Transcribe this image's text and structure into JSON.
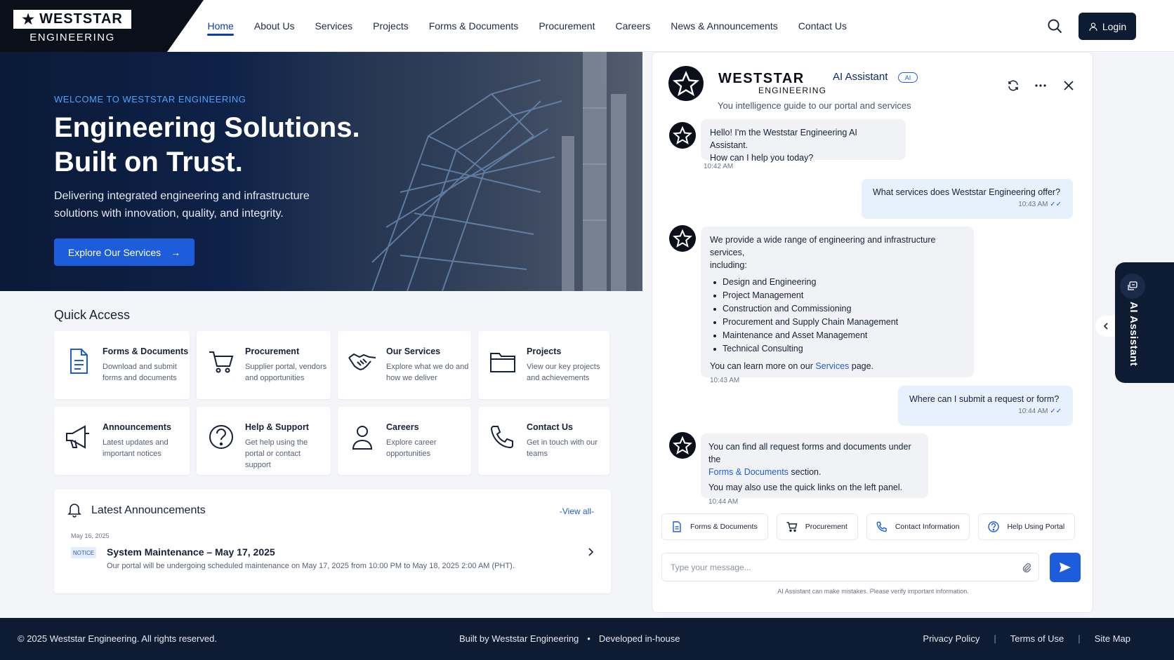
{
  "brand": {
    "name": "WESTSTAR",
    "sub": "ENGINEERING"
  },
  "nav": {
    "items": [
      "Home",
      "About Us",
      "Services",
      "Projects",
      "Forms & Documents",
      "Procurement",
      "Careers",
      "News & Announcements",
      "Contact Us"
    ],
    "active": "Home",
    "login_label": "Login"
  },
  "hero": {
    "eyebrow": "WELCOME TO WESTSTAR ENGINEERING",
    "title_line1": "Engineering Solutions.",
    "title_line2": "Built on Trust.",
    "subtitle": "Delivering integrated engineering and infrastructure solutions with innovation, quality, and integrity.",
    "cta_label": "Explore Our Services"
  },
  "quick_access": {
    "title": "Quick Access",
    "cards": [
      {
        "title": "Forms & Documents",
        "desc": "Download and submit forms and documents",
        "icon": "document-icon"
      },
      {
        "title": "Procurement",
        "desc": "Supplier portal, vendors and opportunities",
        "icon": "cart-icon"
      },
      {
        "title": "Our Services",
        "desc": "Explore what we do and how we deliver",
        "icon": "handshake-icon"
      },
      {
        "title": "Projects",
        "desc": "View our key projects and achievements",
        "icon": "folder-icon"
      },
      {
        "title": "Announcements",
        "desc": "Latest updates and important notices",
        "icon": "megaphone-icon"
      },
      {
        "title": "Help & Support",
        "desc": "Get help using the portal or contact support",
        "icon": "help-icon"
      },
      {
        "title": "Careers",
        "desc": "Explore career opportunities",
        "icon": "person-icon"
      },
      {
        "title": "Contact Us",
        "desc": "Get in touch with our teams",
        "icon": "phone-icon"
      }
    ]
  },
  "announcements": {
    "title": "Latest Announcements",
    "view_all": "-View all-",
    "items": [
      {
        "date": "May 16, 2025",
        "badge": "NOTICE",
        "title": "System Maintenance – May 17, 2025",
        "desc": "Our portal will be undergoing scheduled maintenance on May 17, 2025 from 10:00 PM to May 18, 2025 2:00 AM (PHT)."
      }
    ]
  },
  "chat": {
    "brand": "WESTSTAR",
    "brand_sub": "ENGINEERING",
    "name": "AI Assistant",
    "badge": "AI",
    "tagline": "You intelligence guide to our portal and services",
    "messages": [
      {
        "from": "bot",
        "text1": "Hello! I'm the Weststar Engineering AI Assistant.",
        "text2": "How can I help you today?",
        "time": "10:42 AM"
      },
      {
        "from": "user",
        "text": "What services does Weststar Engineering offer?",
        "time": "10:43 AM"
      },
      {
        "from": "bot",
        "intro1": "We provide a wide range of engineering and infrastructure services,",
        "intro2": "including:",
        "list": [
          "Design and Engineering",
          "Project Management",
          "Construction and Commissioning",
          "Procurement and Supply Chain Management",
          "Maintenance and Asset Management",
          "Technical Consulting"
        ],
        "outro_pre": "You can learn more on our ",
        "outro_link": "Services",
        "outro_post": " page.",
        "time": "10:43 AM"
      },
      {
        "from": "user",
        "text": "Where can I submit a request or form?",
        "time": "10:44 AM"
      },
      {
        "from": "bot",
        "l1": "You can find all request forms and documents under the",
        "link": "Forms & Documents",
        "l2": " section.",
        "l3": "You may also use the quick links on the left panel.",
        "time": "10:44 AM"
      }
    ],
    "chips": [
      "Forms & Documents",
      "Procurement",
      "Contact Information",
      "Help Using Portal"
    ],
    "placeholder": "Type your message...",
    "disclaimer": "AI Assistant can make mistakes. Please verify important information."
  },
  "side_tab": {
    "label": "AI Assistant"
  },
  "footer": {
    "copyright": "© 2025 Weststar Engineering. All rights reserved.",
    "built": "Built by Weststar Engineering",
    "dot": "•",
    "dev": "Developed in-house",
    "links": [
      "Privacy Policy",
      "Terms of Use",
      "Site Map"
    ],
    "divider": "|"
  },
  "colors": {
    "accent": "#1d5ddb",
    "navy": "#0d1b33",
    "user_bubble": "#e7f0fd",
    "bot_bubble": "#f1f2f5"
  }
}
